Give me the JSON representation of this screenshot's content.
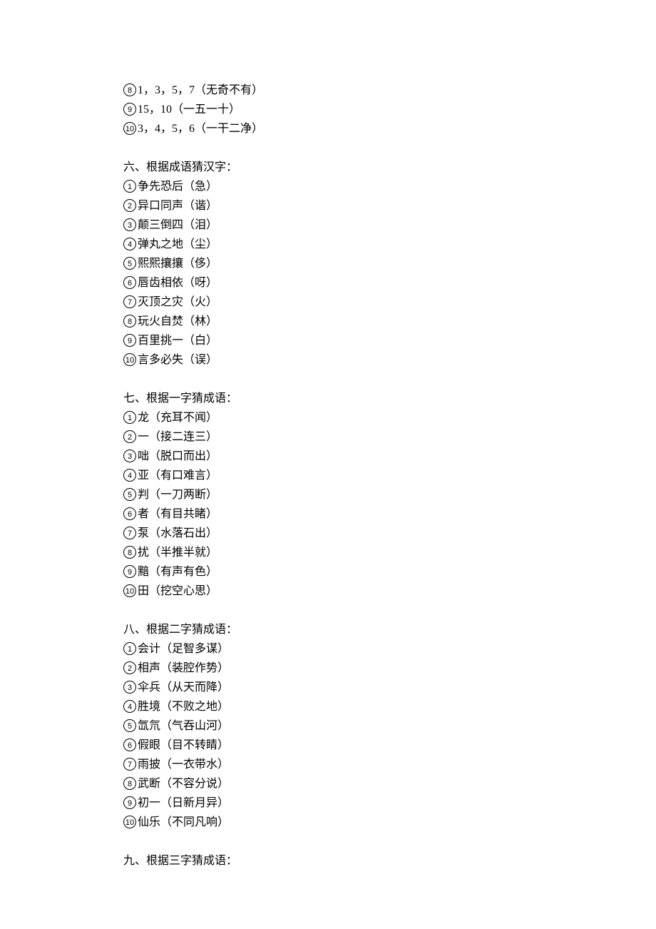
{
  "tail5": [
    {
      "n": "8",
      "t": "1，3，5，7（无奇不有）"
    },
    {
      "n": "9",
      "t": "15，10（一五一十）"
    },
    {
      "n": "10",
      "t": "3，4，5，6（一干二净）"
    }
  ],
  "s6": {
    "heading": "六、根据成语猜汉字：",
    "items": [
      {
        "n": "1",
        "t": "争先恐后（急）"
      },
      {
        "n": "2",
        "t": "异口同声（谐）"
      },
      {
        "n": "3",
        "t": "颠三倒四（泪）"
      },
      {
        "n": "4",
        "t": "弹丸之地（尘）"
      },
      {
        "n": "5",
        "t": "熙熙攘攘（侈）"
      },
      {
        "n": "6",
        "t": "唇齿相依（呀）"
      },
      {
        "n": "7",
        "t": "灭顶之灾（火）"
      },
      {
        "n": "8",
        "t": "玩火自焚（林）"
      },
      {
        "n": "9",
        "t": "百里挑一（白）"
      },
      {
        "n": "10",
        "t": "言多必失（误）"
      }
    ]
  },
  "s7": {
    "heading": "七、根据一字猜成语：",
    "items": [
      {
        "n": "1",
        "t": "龙（充耳不闻）"
      },
      {
        "n": "2",
        "t": "一（接二连三）"
      },
      {
        "n": "3",
        "t": "咄（脱口而出）"
      },
      {
        "n": "4",
        "t": "亚（有口难言）"
      },
      {
        "n": "5",
        "t": "判（一刀两断）"
      },
      {
        "n": "6",
        "t": "者（有目共睹）"
      },
      {
        "n": "7",
        "t": "泵（水落石出）"
      },
      {
        "n": "8",
        "t": "扰（半推半就）"
      },
      {
        "n": "9",
        "t": "黯（有声有色）"
      },
      {
        "n": "10",
        "t": "田（挖空心思）"
      }
    ]
  },
  "s8": {
    "heading": "八、根据二字猜成语：",
    "items": [
      {
        "n": "1",
        "t": "会计（足智多谋）"
      },
      {
        "n": "2",
        "t": "相声（装腔作势）"
      },
      {
        "n": "3",
        "t": "伞兵（从天而降）"
      },
      {
        "n": "4",
        "t": "胜境（不败之地）"
      },
      {
        "n": "5",
        "t": "氙氘（气吞山河）"
      },
      {
        "n": "6",
        "t": "假眼（目不转睛）"
      },
      {
        "n": "7",
        "t": "雨披（一衣带水）"
      },
      {
        "n": "8",
        "t": "武断（不容分说）"
      },
      {
        "n": "9",
        "t": "初一（日新月异）"
      },
      {
        "n": "10",
        "t": "仙乐（不同凡响）"
      }
    ]
  },
  "s9": {
    "heading": "九、根据三字猜成语："
  }
}
